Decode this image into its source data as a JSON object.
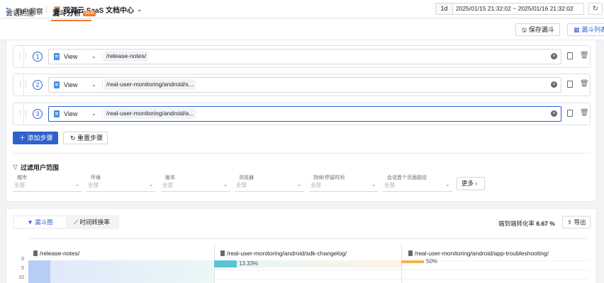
{
  "topbar": {
    "back_label": "用户洞察",
    "workspace": "观测云 SaaS 文档中心",
    "range_unit": "1d",
    "range_text": "2025/01/15 21:32:02 ~ 2025/01/16 21:32:02"
  },
  "tabs": {
    "session_heatmap": "会话热图",
    "funnel_analysis": "漏斗分析",
    "new_badge": "NEW",
    "save_funnel": "保存漏斗",
    "funnel_list": "漏斗列表"
  },
  "steps": [
    {
      "number": "1",
      "type": "View",
      "path": "/release-notes/"
    },
    {
      "number": "2",
      "type": "View",
      "path": "/real-user-monitoring/android/s..."
    },
    {
      "number": "3",
      "type": "View",
      "path": "/real-user-monitoring/android/a..."
    }
  ],
  "actions": {
    "add_step": "添加步骤",
    "reset_steps": "重置步骤"
  },
  "filter": {
    "title": "过滤用户范围",
    "fields": [
      {
        "label": "城市",
        "value": "全部"
      },
      {
        "label": "环境",
        "value": "全部"
      },
      {
        "label": "版本",
        "value": "全部"
      },
      {
        "label": "浏览器",
        "value": "全部"
      },
      {
        "label": "持续/停留时间",
        "value": "全部"
      },
      {
        "label": "会话首个页面路径",
        "value": "全部"
      }
    ],
    "more": "更多"
  },
  "chart_panel": {
    "seg_funnel": "漏斗图",
    "seg_time": "时间转换率",
    "conversion_label": "端到端转化率",
    "conversion_value": "6.67 %",
    "export": "导出"
  },
  "chart_data": {
    "type": "bar",
    "categories": [
      "/release-notes/",
      "/real-user-monitoring/android/sdk-changelog/",
      "/real-user-monitoring/android/app-troubleshooting/"
    ],
    "step_conversion_labels": [
      "",
      "13.33%",
      "50%"
    ],
    "yticks": [
      "0",
      "5",
      "10"
    ]
  }
}
